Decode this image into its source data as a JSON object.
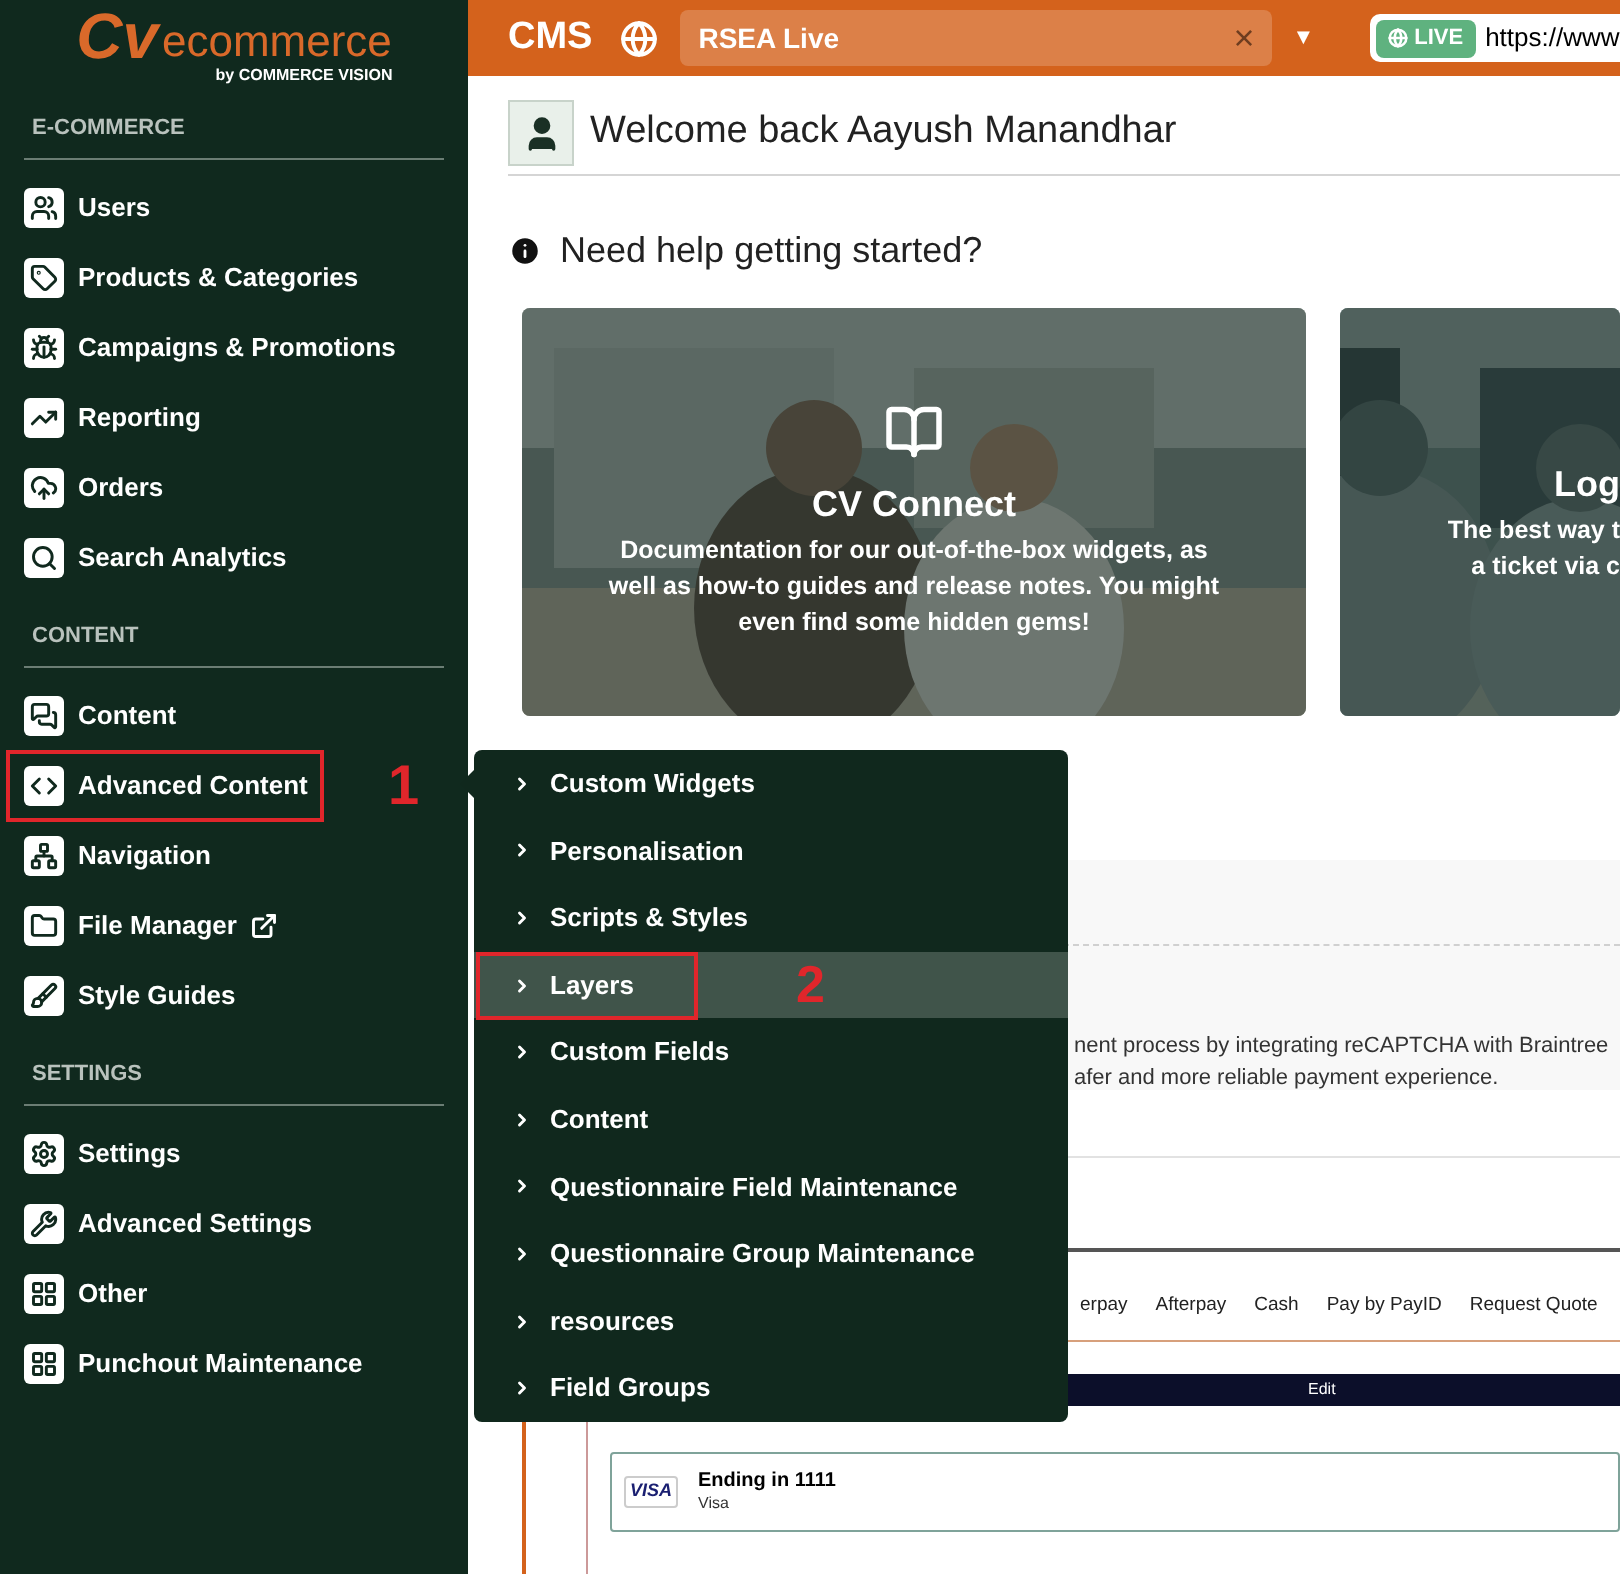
{
  "brand": {
    "logo_mark": "Cv",
    "logo_word": "ecommerce",
    "tagline": "by COMMERCE VISION"
  },
  "topbar": {
    "app": "CMS",
    "site_selector": {
      "value": "RSEA Live",
      "clear": "×",
      "caret": "▼"
    },
    "live_badge": "LIVE",
    "url": "https://www"
  },
  "sidebar": {
    "sections": [
      {
        "heading": "E-COMMERCE",
        "items": [
          {
            "label": "Users"
          },
          {
            "label": "Products & Categories"
          },
          {
            "label": "Campaigns & Promotions"
          },
          {
            "label": "Reporting"
          },
          {
            "label": "Orders"
          },
          {
            "label": "Search Analytics"
          }
        ]
      },
      {
        "heading": "CONTENT",
        "items": [
          {
            "label": "Content"
          },
          {
            "label": "Advanced Content",
            "annotation": "1"
          },
          {
            "label": "Navigation"
          },
          {
            "label": "File Manager",
            "external": true
          },
          {
            "label": "Style Guides"
          }
        ]
      },
      {
        "heading": "SETTINGS",
        "items": [
          {
            "label": "Settings"
          },
          {
            "label": "Advanced Settings"
          },
          {
            "label": "Other"
          },
          {
            "label": "Punchout Maintenance"
          }
        ]
      }
    ]
  },
  "flyout": {
    "items": [
      {
        "label": "Custom Widgets",
        "selected": false
      },
      {
        "label": "Personalisation",
        "selected": false
      },
      {
        "label": "Scripts & Styles",
        "selected": false
      },
      {
        "label": "Layers",
        "selected": true,
        "annotation": "2"
      },
      {
        "label": "Custom Fields",
        "selected": false
      },
      {
        "label": "Content",
        "selected": false
      },
      {
        "label": "Questionnaire Field Maintenance",
        "selected": false
      },
      {
        "label": "Questionnaire Group Maintenance",
        "selected": false
      },
      {
        "label": "resources",
        "selected": false
      },
      {
        "label": "Field Groups",
        "selected": false
      }
    ]
  },
  "welcome": "Welcome back Aayush Manandhar",
  "help_heading": "Need help getting started?",
  "help_cards": [
    {
      "title": "CV Connect",
      "lines": [
        "Documentation for our out-of-the-box widgets, as well as how-to guides and release notes. You might even find some hidden gems!"
      ]
    },
    {
      "title": "Log",
      "lines": [
        "The best way t",
        "a ticket via c"
      ]
    }
  ],
  "panel_lines": [
    "nent process by integrating reCAPTCHA with Braintree",
    "afer and more reliable payment experience."
  ],
  "payment_tabs": [
    "erpay",
    "Afterpay",
    "Cash",
    "Pay by PayID",
    "Request Quote"
  ],
  "edit_bar": "Edit",
  "saved_card": {
    "brand": "VISA",
    "title": "Ending in 1111",
    "subtitle": "Visa"
  }
}
